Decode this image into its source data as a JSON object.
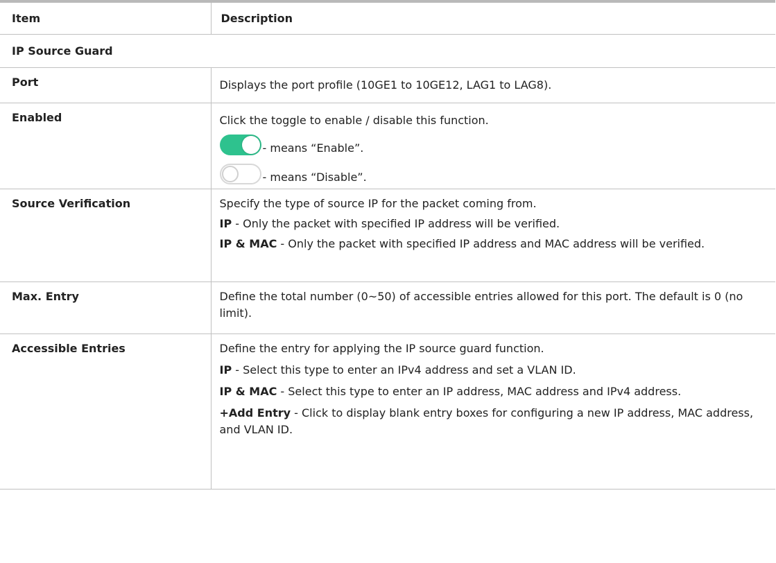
{
  "header": {
    "item": "Item",
    "description": "Description"
  },
  "section_title": "IP Source Guard",
  "rows": {
    "port": {
      "label": "Port",
      "desc": "Displays the port profile (10GE1 to 10GE12, LAG1 to LAG8)."
    },
    "enabled": {
      "label": "Enabled",
      "desc": "Click the toggle to enable / disable this function.",
      "on_caption": "- means “Enable”.",
      "off_caption": "- means “Disable”."
    },
    "source_verification": {
      "label": "Source Verification",
      "desc": "Specify the type of source IP for the packet coming from.",
      "ip_term": "IP",
      "ip_text": " - Only the packet with specified IP address will be verified.",
      "ipmac_term": "IP & MAC",
      "ipmac_text": " - Only the packet with specified IP address and MAC address will be verified."
    },
    "max_entry": {
      "label": "Max. Entry",
      "desc": "Define the total number (0~50) of accessible entries allowed for this port. The default is 0 (no limit)."
    },
    "accessible_entries": {
      "label": "Accessible Entries",
      "desc": "Define the entry for applying the IP source guard function.",
      "ip_term": "IP",
      "ip_text": " - Select this type to enter an IPv4 address and set a VLAN ID.",
      "ipmac_term": "IP & MAC",
      "ipmac_text": " - Select this type to enter an IP address, MAC address and IPv4 address.",
      "add_term": "+Add Entry",
      "add_text": " - Click to display blank entry boxes for configuring a new IP address, MAC address, and VLAN ID."
    }
  },
  "colors": {
    "toggle_on": "#2ec28e",
    "toggle_off_border": "#d8d8d8",
    "rule": "#c0c0c0"
  }
}
